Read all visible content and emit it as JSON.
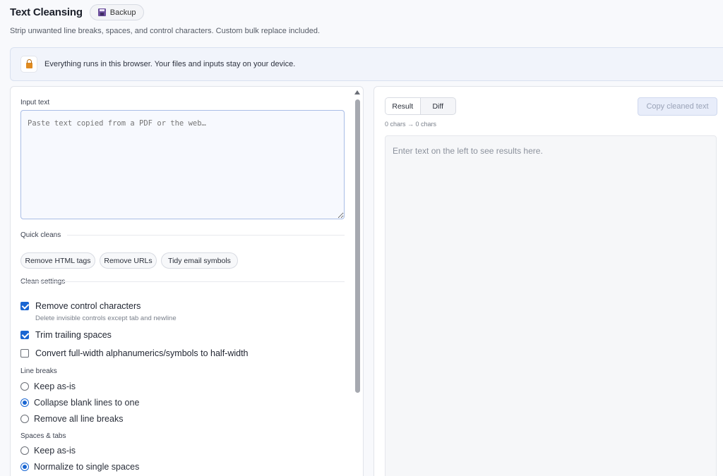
{
  "header": {
    "title": "Text Cleansing",
    "backup_label": "Backup",
    "subtitle": "Strip unwanted line breaks, spaces, and control characters. Custom bulk replace included."
  },
  "notice": {
    "text": "Everything runs in this browser. Your files and inputs stay on your device."
  },
  "input": {
    "label": "Input text",
    "placeholder": "Paste text copied from a PDF or the web…",
    "value": ""
  },
  "quick_cleans": {
    "heading": "Quick cleans",
    "buttons": [
      "Remove HTML tags",
      "Remove URLs",
      "Tidy email symbols"
    ]
  },
  "settings": {
    "heading": "Clean settings",
    "checks": [
      {
        "label": "Remove control characters",
        "hint": "Delete invisible controls except tab and newline",
        "checked": true
      },
      {
        "label": "Trim trailing spaces",
        "hint": "",
        "checked": true
      },
      {
        "label": "Convert full-width alphanumerics/symbols to half-width",
        "hint": "",
        "checked": false
      }
    ],
    "line_breaks": {
      "heading": "Line breaks",
      "options": [
        "Keep as-is",
        "Collapse blank lines to one",
        "Remove all line breaks"
      ],
      "selected": "Collapse blank lines to one"
    },
    "spaces_tabs": {
      "heading": "Spaces & tabs",
      "options": [
        "Keep as-is",
        "Normalize to single spaces"
      ],
      "selected": "Normalize to single spaces"
    }
  },
  "output": {
    "tabs": [
      "Result",
      "Diff"
    ],
    "active_tab": "Result",
    "copy_label": "Copy cleaned text",
    "char_count": "0 chars → 0 chars",
    "empty_message": "Enter text on the left to see results here."
  },
  "colors": {
    "accent": "#1a66d2",
    "page_bg": "#f8f9fc",
    "notice_bg": "#f1f4fb",
    "copy_button_bg": "#e8edfa"
  },
  "icons": {
    "backup": "floppy-disk-icon",
    "notice": "lock-icon"
  }
}
